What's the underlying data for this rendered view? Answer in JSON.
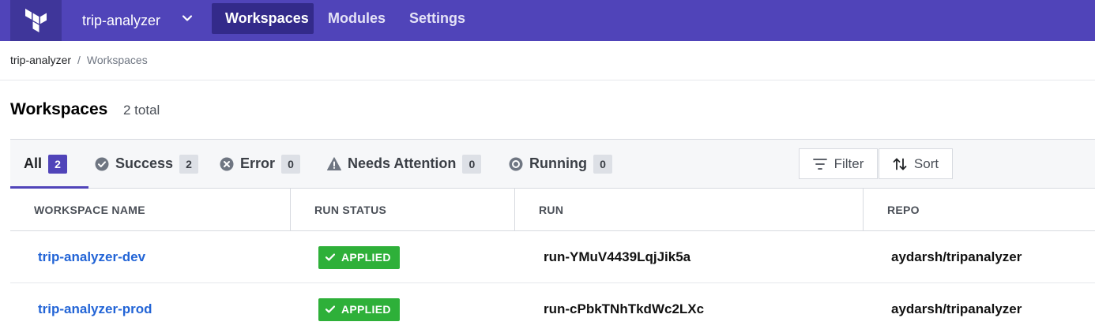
{
  "nav": {
    "org_name": "trip-analyzer",
    "items": [
      {
        "label": "Workspaces",
        "active": true
      },
      {
        "label": "Modules",
        "active": false
      },
      {
        "label": "Settings",
        "active": false
      }
    ],
    "colors": {
      "background": "#5044b9",
      "active": "#332a8a"
    }
  },
  "breadcrumb": {
    "org": "trip-analyzer",
    "separator": "/",
    "current": "Workspaces"
  },
  "page": {
    "title": "Workspaces",
    "count": "2 total"
  },
  "tabs": [
    {
      "label": "All",
      "count": "2",
      "icon": "none",
      "active": true
    },
    {
      "label": "Success",
      "count": "2",
      "icon": "check-circle-icon",
      "active": false
    },
    {
      "label": "Error",
      "count": "0",
      "icon": "x-circle-icon",
      "active": false
    },
    {
      "label": "Needs Attention",
      "count": "0",
      "icon": "warning-icon",
      "active": false
    },
    {
      "label": "Running",
      "count": "0",
      "icon": "running-icon",
      "active": false
    }
  ],
  "toolbar": {
    "filter_label": "Filter",
    "sort_label": "Sort"
  },
  "table": {
    "columns": [
      "WORKSPACE NAME",
      "RUN STATUS",
      "RUN",
      "REPO"
    ],
    "rows": [
      {
        "name": "trip-analyzer-dev",
        "status": "APPLIED",
        "run": "run-YMuV4439LqjJik5a",
        "repo": "aydarsh/tripanalyzer"
      },
      {
        "name": "trip-analyzer-prod",
        "status": "APPLIED",
        "run": "run-cPbkTNhTkdWc2LXc",
        "repo": "aydarsh/tripanalyzer"
      }
    ],
    "status_color": "#2eb039",
    "link_color": "#2264d6"
  }
}
